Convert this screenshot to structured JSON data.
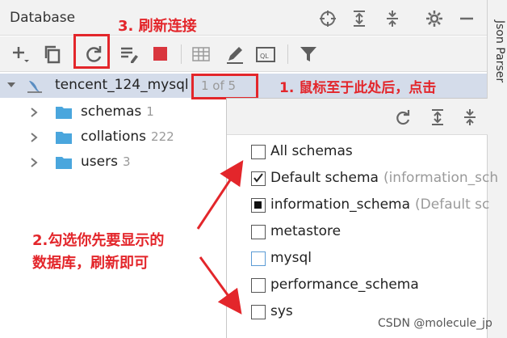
{
  "panel": {
    "title": "Database",
    "side_tab": "Json Parser"
  },
  "tree": {
    "datasource": {
      "name": "tencent_124_mysql",
      "count": "1 of 5"
    },
    "items": [
      {
        "label": "schemas",
        "count": "1"
      },
      {
        "label": "collations",
        "count": "222"
      },
      {
        "label": "users",
        "count": "3"
      }
    ]
  },
  "schema_popup": {
    "options": [
      {
        "label": "All schemas",
        "note": "",
        "state": "unchecked"
      },
      {
        "label": "Default schema",
        "note": "(information_sch",
        "state": "checked"
      },
      {
        "label": "information_schema",
        "note": "(Default sc",
        "state": "indeterminate"
      },
      {
        "label": "metastore",
        "note": "",
        "state": "unchecked"
      },
      {
        "label": "mysql",
        "note": "",
        "state": "unchecked-focused"
      },
      {
        "label": "performance_schema",
        "note": "",
        "state": "unchecked"
      },
      {
        "label": "sys",
        "note": "",
        "state": "unchecked"
      }
    ]
  },
  "annotations": {
    "step1": "1. 鼠标至于此处后，点击",
    "step2_line1": "2.勾选你先要显示的",
    "step2_line2": "数据库，刷新即可",
    "step3": "3. 刷新连接"
  },
  "watermark": "CSDN @molecule_jp",
  "colors": {
    "annotation": "#e3262b",
    "selection": "#d4dcea",
    "folder": "#4aa6dd",
    "stop": "#d9363e"
  }
}
